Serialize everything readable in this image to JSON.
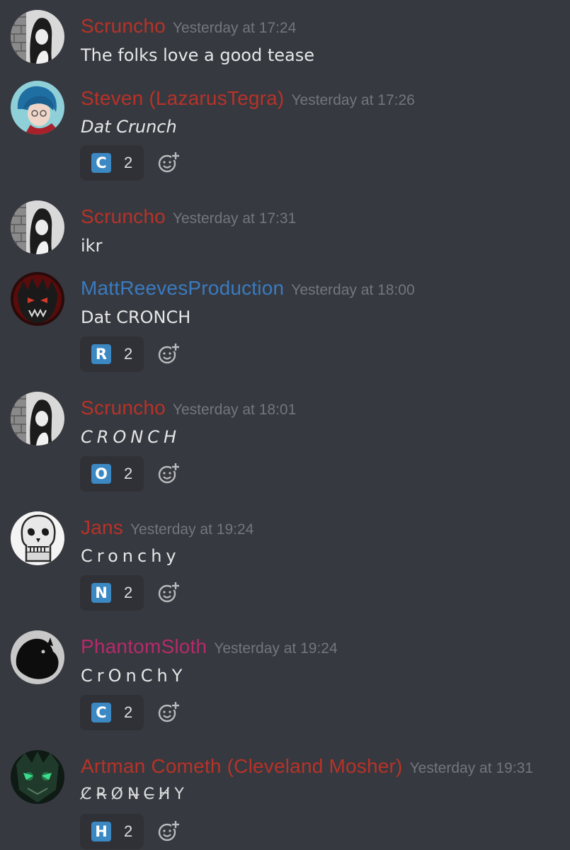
{
  "colors": {
    "background": "#36393f",
    "reaction_bg": "#2f3136",
    "timestamp": "#72767d",
    "emoji_blue": "#3b88c3",
    "red_role": "#c0392b",
    "blue_role": "#3b82c4",
    "pink_role": "#c2306a"
  },
  "messages": [
    {
      "author": "Scruncho",
      "author_color": "#b83228",
      "timestamp": "Yesterday at 17:24",
      "content": "The folks love a good tease",
      "avatar_icon": "scruncho-avatar"
    },
    {
      "author": "Steven (LazarusTegra)",
      "author_color": "#b83228",
      "timestamp": "Yesterday at 17:26",
      "content": "Dat Crunch",
      "avatar_icon": "anime-avatar",
      "reaction": {
        "emoji": "C",
        "count": "2"
      }
    },
    {
      "author": "Scruncho",
      "author_color": "#b83228",
      "timestamp": "Yesterday at 17:31",
      "content": "ikr",
      "avatar_icon": "scruncho-avatar"
    },
    {
      "author": "MattReevesProduction",
      "author_color": "#3a7bc0",
      "timestamp": "Yesterday at 18:00",
      "content": "Dat CRONCH",
      "avatar_icon": "monster-avatar",
      "reaction": {
        "emoji": "R",
        "count": "2"
      }
    },
    {
      "author": "Scruncho",
      "author_color": "#b83228",
      "timestamp": "Yesterday at 18:01",
      "content": "CRONCH",
      "avatar_icon": "scruncho-avatar",
      "reaction": {
        "emoji": "O",
        "count": "2"
      }
    },
    {
      "author": "Jans",
      "author_color": "#b83228",
      "timestamp": "Yesterday at 19:24",
      "content": "Cronchy",
      "avatar_icon": "skull-avatar",
      "reaction": {
        "emoji": "N",
        "count": "2"
      }
    },
    {
      "author": "PhantomSloth",
      "author_color": "#b62a6a",
      "timestamp": "Yesterday at 19:24",
      "content": "CrOnChY",
      "avatar_icon": "sloth-avatar",
      "reaction": {
        "emoji": "C",
        "count": "2"
      }
    },
    {
      "author": "Artman Cometh (Cleveland Mosher)",
      "author_color": "#b83228",
      "timestamp": "Yesterday at 19:31",
      "content": "C̸R̶O̸N̶C̶H̸Y",
      "avatar_icon": "alien-avatar",
      "reaction": {
        "emoji": "H",
        "count": "2"
      }
    }
  ]
}
